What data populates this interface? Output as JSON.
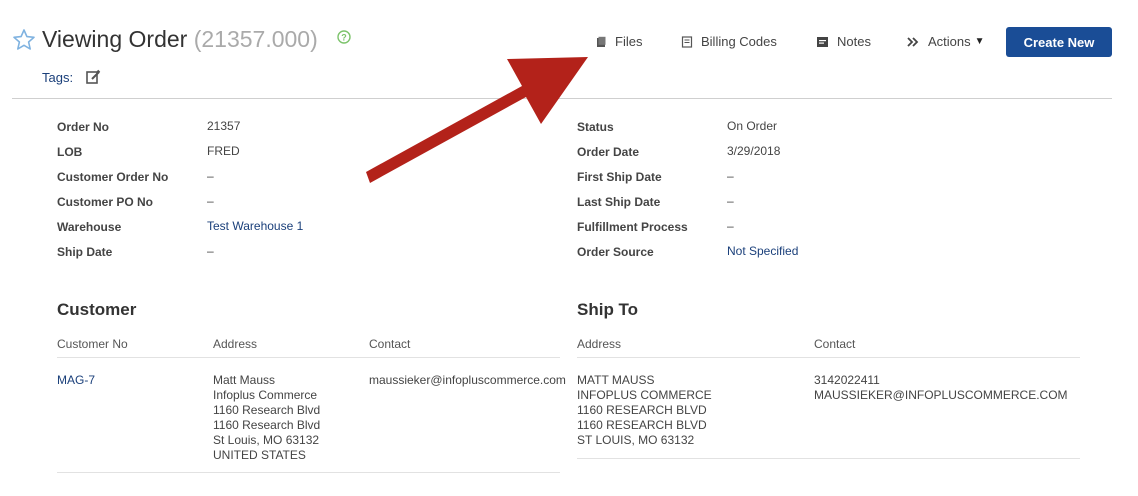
{
  "header": {
    "title_prefix": "Viewing Order",
    "title_number": "(21357.000)",
    "tags_label": "Tags:"
  },
  "toolbar": {
    "files": "Files",
    "billing_codes": "Billing Codes",
    "notes": "Notes",
    "actions": "Actions",
    "actions_caret": "▼",
    "create_new": "Create New"
  },
  "details_left": [
    {
      "label": "Order No",
      "value": "21357"
    },
    {
      "label": "LOB",
      "value": "FRED"
    },
    {
      "label": "Customer Order No",
      "value": "–"
    },
    {
      "label": "Customer PO No",
      "value": "–"
    },
    {
      "label": "Warehouse",
      "value": "Test Warehouse 1"
    },
    {
      "label": "Ship Date",
      "value": "–"
    }
  ],
  "details_right": [
    {
      "label": "Status",
      "value": "On Order"
    },
    {
      "label": "Order Date",
      "value": "3/29/2018"
    },
    {
      "label": "First Ship Date",
      "value": "–"
    },
    {
      "label": "Last Ship Date",
      "value": "–"
    },
    {
      "label": "Fulfillment Process",
      "value": "–"
    },
    {
      "label": "Order Source",
      "value": "Not Specified"
    }
  ],
  "customer": {
    "heading": "Customer",
    "headers": [
      "Customer No",
      "Address",
      "Contact"
    ],
    "customer_no": "MAG-7",
    "address": [
      "Matt Mauss",
      "Infoplus Commerce",
      "1160 Research Blvd",
      "1160 Research Blvd",
      "St Louis, MO 63132",
      "UNITED STATES"
    ],
    "contact": "maussieker@infopluscommerce.com"
  },
  "ship_to": {
    "heading": "Ship To",
    "headers": [
      "Address",
      "Contact"
    ],
    "address": [
      "MATT MAUSS",
      "INFOPLUS COMMERCE",
      "1160 RESEARCH BLVD",
      "1160 RESEARCH BLVD",
      "ST LOUIS, MO 63132"
    ],
    "contact": [
      "3142022411",
      "MAUSSIEKER@INFOPLUSCOMMERCE.COM"
    ]
  },
  "colors": {
    "accent": "#1a4d96",
    "link": "#1a3f7a",
    "star": "#7fb2e0",
    "help": "#7cc36b",
    "annotation_arrow": "#b3221a"
  }
}
